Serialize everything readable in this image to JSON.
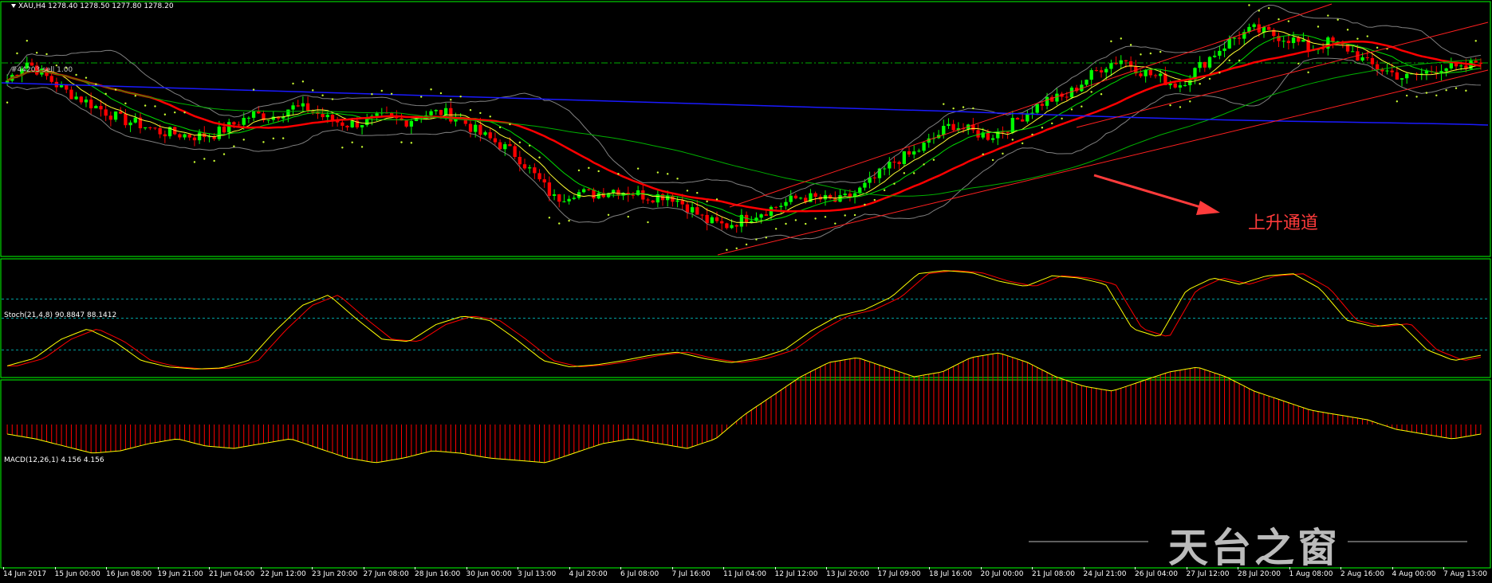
{
  "main_panel": {
    "header": "XAU,H4  1278.40 1278.50 1277.80 1278.20",
    "marker_label": "#44203 sell 1.00",
    "annotation": "上升通道"
  },
  "stoch_panel": {
    "header": "Stoch(21,4,8) 90.8847 88.1412"
  },
  "macd_panel": {
    "header": "MACD(12,26,1) 4.156 4.156"
  },
  "watermark": "天台之窗",
  "time_axis": [
    "14 Jun 2017",
    "15 Jun 00:00",
    "16 Jun 08:00",
    "19 Jun 21:00",
    "21 Jun 04:00",
    "22 Jun 12:00",
    "23 Jun 20:00",
    "27 Jun 08:00",
    "28 Jun 16:00",
    "30 Jun 00:00",
    "3 Jul 13:00",
    "4 Jul 20:00",
    "6 Jul 08:00",
    "7 Jul 16:00",
    "11 Jul 04:00",
    "12 Jul 12:00",
    "13 Jul 20:00",
    "17 Jul 09:00",
    "18 Jul 16:00",
    "20 Jul 00:00",
    "21 Jul 08:00",
    "24 Jul 21:00",
    "26 Jul 04:00",
    "27 Jul 12:00",
    "28 Jul 20:00",
    "1 Aug 08:00",
    "2 Aug 16:00",
    "4 Aug 00:00",
    "7 Aug 13:00"
  ],
  "colors": {
    "bull_candle": "#00ff00",
    "bear_candle": "#ff0000",
    "ma_red": "#ff0000",
    "ma_blue": "#1a1aff",
    "ma_green": "#00b000",
    "bollinger": "#808080",
    "sar": "#ccff33",
    "stoch_main": "#ffff00",
    "stoch_signal": "#ff0000",
    "macd_hist": "#ff0000",
    "macd_signal": "#ffff00",
    "panel_border": "#00ff00"
  },
  "chart_data": {
    "type": "candlestick",
    "symbol": "XAU",
    "timeframe": "H4",
    "close_profile": [
      1270,
      1278,
      1272,
      1266,
      1262,
      1258,
      1254,
      1252,
      1249,
      1248,
      1247,
      1248,
      1252,
      1256,
      1255,
      1259,
      1258,
      1254,
      1252,
      1253,
      1255,
      1253,
      1256,
      1257,
      1254,
      1248,
      1244,
      1239,
      1230,
      1221,
      1224,
      1223,
      1225,
      1224,
      1222,
      1223,
      1218,
      1212,
      1210,
      1213,
      1216,
      1219,
      1222,
      1221,
      1220,
      1224,
      1230,
      1237,
      1240,
      1246,
      1252,
      1249,
      1247,
      1251,
      1257,
      1262,
      1263,
      1270,
      1276,
      1279,
      1274,
      1271,
      1268,
      1275,
      1282,
      1288,
      1291,
      1289,
      1287,
      1283,
      1286,
      1283,
      1277,
      1274,
      1271,
      1273,
      1276,
      1274,
      1279
    ],
    "stoch_profile": [
      5,
      12,
      30,
      40,
      28,
      10,
      4,
      2,
      3,
      10,
      38,
      62,
      72,
      50,
      30,
      28,
      44,
      52,
      48,
      30,
      10,
      4,
      6,
      10,
      15,
      18,
      12,
      8,
      12,
      20,
      38,
      52,
      58,
      70,
      92,
      95,
      93,
      85,
      80,
      90,
      88,
      82,
      40,
      32,
      76,
      88,
      82,
      90,
      92,
      78,
      48,
      42,
      45,
      20,
      10,
      15
    ],
    "macd_profile": [
      -2,
      -3,
      -4.5,
      -6,
      -5.5,
      -4,
      -3,
      -4.5,
      -5,
      -4,
      -3,
      -5,
      -7,
      -8,
      -7,
      -5.5,
      -6,
      -7,
      -7.5,
      -8,
      -6,
      -4,
      -3,
      -4,
      -5,
      -3,
      2,
      6,
      10,
      13,
      14,
      12,
      10,
      11,
      14,
      15,
      13,
      10,
      8,
      7,
      9,
      11,
      12,
      10,
      7,
      5,
      3,
      2,
      1,
      -1,
      -2,
      -3,
      -2
    ]
  }
}
